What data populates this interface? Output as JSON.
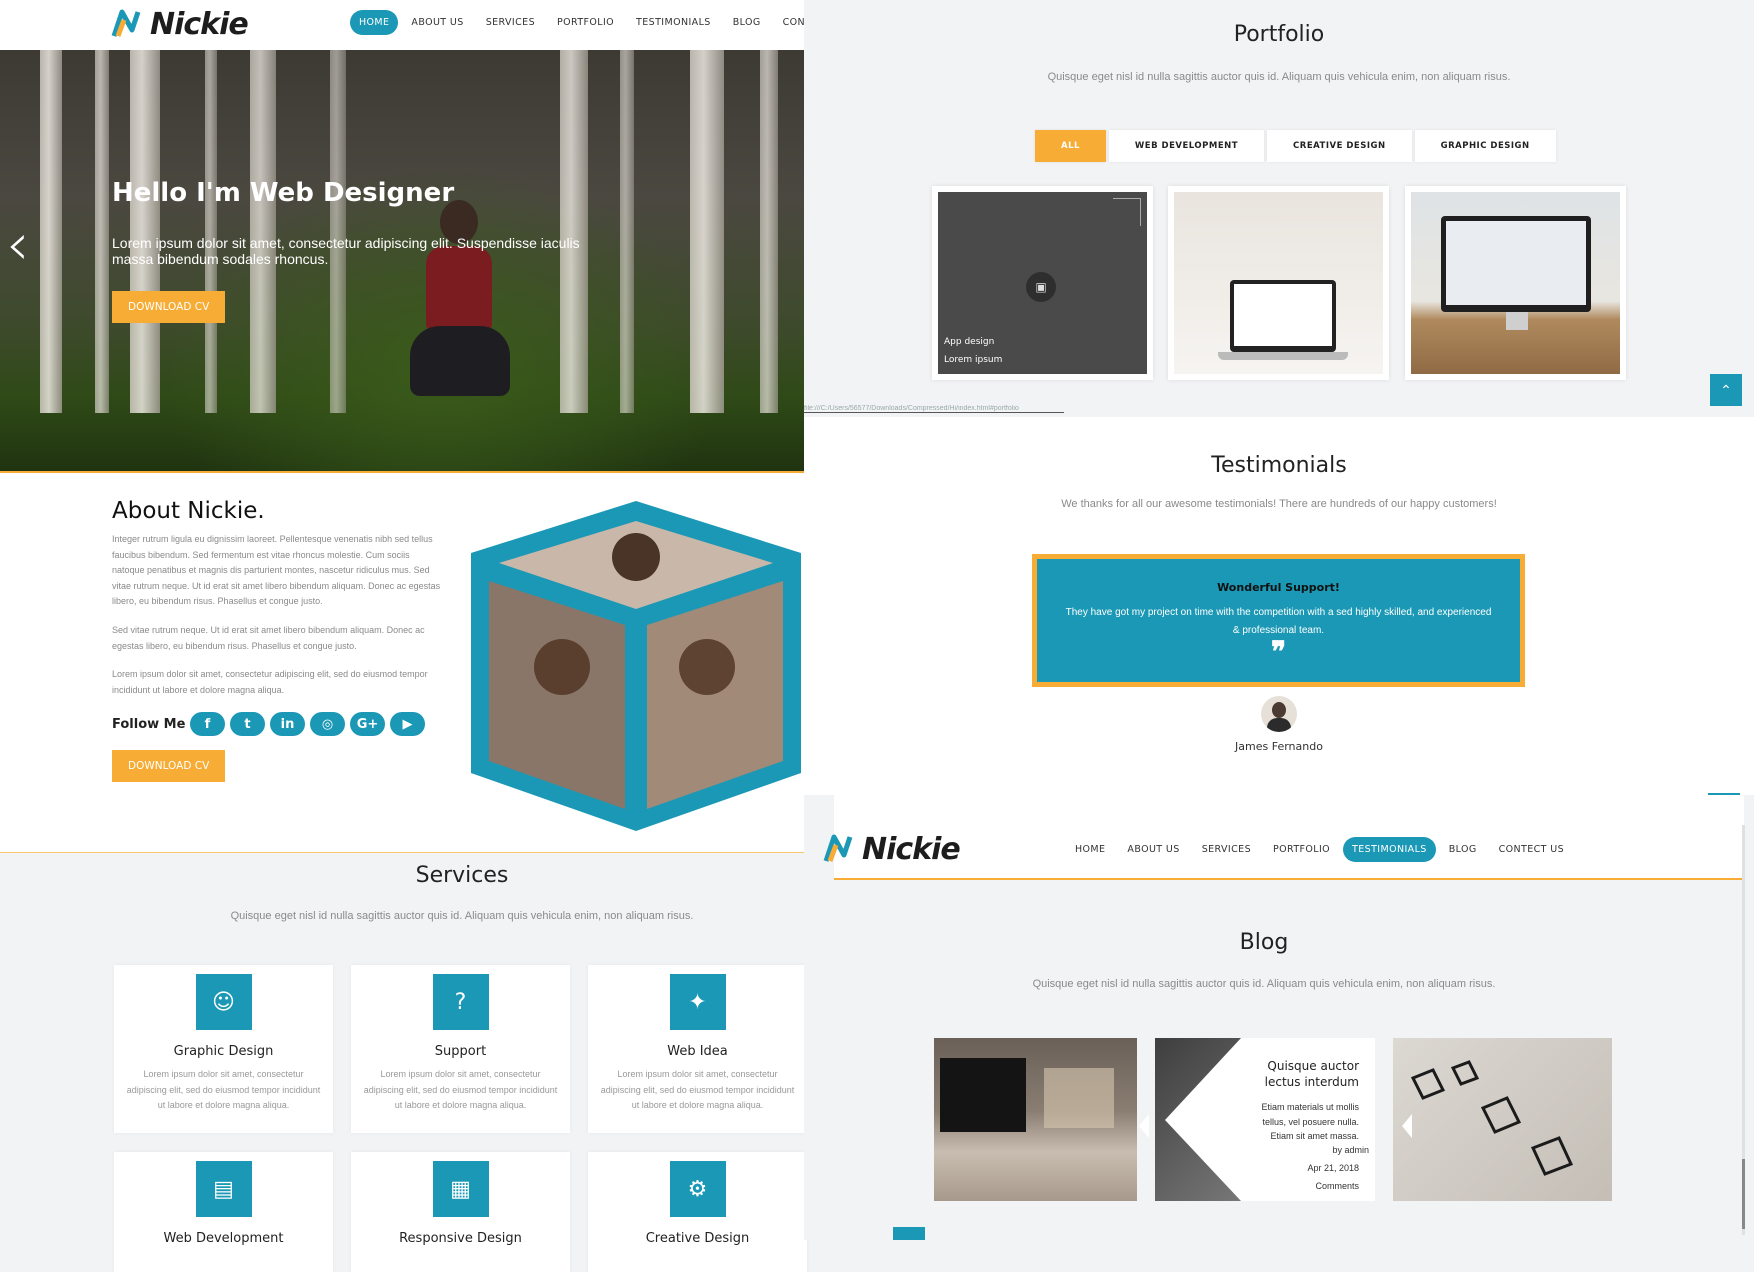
{
  "brand": {
    "name": "Nickie"
  },
  "nav_top": {
    "items": [
      "HOME",
      "ABOUT US",
      "SERVICES",
      "PORTFOLIO",
      "TESTIMONIALS",
      "BLOG",
      "CONTECT US"
    ],
    "active": "HOME"
  },
  "hero": {
    "title": "Hello I'm Web Designer",
    "text": "Lorem ipsum dolor sit amet, consectetur adipiscing elit. Suspendisse iaculis massa bibendum sodales rhoncus.",
    "button": "DOWNLOAD CV"
  },
  "about": {
    "title": "About Nickie.",
    "p1": "Integer rutrum ligula eu dignissim laoreet. Pellentesque venenatis nibh sed tellus faucibus bibendum. Sed fermentum est vitae rhoncus molestie. Cum sociis natoque penatibus et magnis dis parturient montes, nascetur ridiculus mus. Sed vitae rutrum neque. Ut id erat sit amet libero bibendum aliquam. Donec ac egestas libero, eu bibendum risus. Phasellus et congue justo.",
    "p2": "Sed vitae rutrum neque. Ut id erat sit amet libero bibendum aliquam. Donec ac egestas libero, eu bibendum risus. Phasellus et congue justo.",
    "p3": "Lorem ipsum dolor sit amet, consectetur adipiscing elit, sed do eiusmod tempor incididunt ut labore et dolore magna aliqua.",
    "follow_label": "Follow Me",
    "social": [
      "facebook-icon",
      "twitter-icon",
      "linkedin-icon",
      "instagram-icon",
      "google-plus-icon",
      "youtube-icon"
    ],
    "button": "DOWNLOAD CV"
  },
  "services": {
    "title": "Services",
    "subtitle": "Quisque eget nisl id nulla sagittis auctor quis id. Aliquam quis vehicula enim, non aliquam risus.",
    "cards": [
      {
        "title": "Graphic Design",
        "text": "Lorem ipsum dolor sit amet, consectetur adipiscing elit, sed do eiusmod tempor incididunt ut labore et dolore magna aliqua.",
        "icon": "head-gears-icon"
      },
      {
        "title": "Support",
        "text": "Lorem ipsum dolor sit amet, consectetur adipiscing elit, sed do eiusmod tempor incididunt ut labore et dolore magna aliqua.",
        "icon": "chat-question-icon"
      },
      {
        "title": "Web Idea",
        "text": "Lorem ipsum dolor sit amet, consectetur adipiscing elit, sed do eiusmod tempor incididunt ut labore et dolore magna aliqua.",
        "icon": "lightbulb-icon"
      },
      {
        "title": "Web Development",
        "text": "",
        "icon": "monitor-chart-icon"
      },
      {
        "title": "Responsive Design",
        "text": "",
        "icon": "devices-icon"
      },
      {
        "title": "Creative Design",
        "text": "",
        "icon": "gear-tools-icon"
      }
    ]
  },
  "portfolio": {
    "title": "Portfolio",
    "subtitle": "Quisque eget nisl id nulla sagittis auctor quis id. Aliquam quis vehicula enim, non aliquam risus.",
    "tabs": [
      "ALL",
      "WEB DEVELOPMENT",
      "CREATIVE DESIGN",
      "GRAPHIC DESIGN"
    ],
    "active_tab": "ALL",
    "hover_item": {
      "line1": "App design",
      "line2": "Lorem ipsum"
    },
    "status_url": "file:///C:/Users/56577/Downloads/Compressed/Hi/index.html#portfolio"
  },
  "testimonials": {
    "title": "Testimonials",
    "subtitle": "We thanks for all our awesome testimonials! There are hundreds of our happy customers!",
    "quote_title": "Wonderful Support!",
    "quote_text": "They have got my project on time with the competition with a sed highly skilled, and experienced & professional team.",
    "author": "James Fernando"
  },
  "nav_sticky": {
    "items": [
      "HOME",
      "ABOUT US",
      "SERVICES",
      "PORTFOLIO",
      "TESTIMONIALS",
      "BLOG",
      "CONTECT US"
    ],
    "active": "TESTIMONIALS"
  },
  "blog": {
    "title": "Blog",
    "subtitle": "Quisque eget nisl id nulla sagittis auctor quis id. Aliquam quis vehicula enim, non aliquam risus.",
    "post": {
      "title": "Quisque auctor lectus interdum",
      "text": "Etiam materials ut mollis tellus, vel posuere nulla. Etiam sit amet massa.",
      "by": "by admin",
      "date": "Apr 21, 2018",
      "comments": "Comments"
    }
  },
  "colors": {
    "accent": "#1b98b5",
    "orange": "#f6ac35"
  }
}
